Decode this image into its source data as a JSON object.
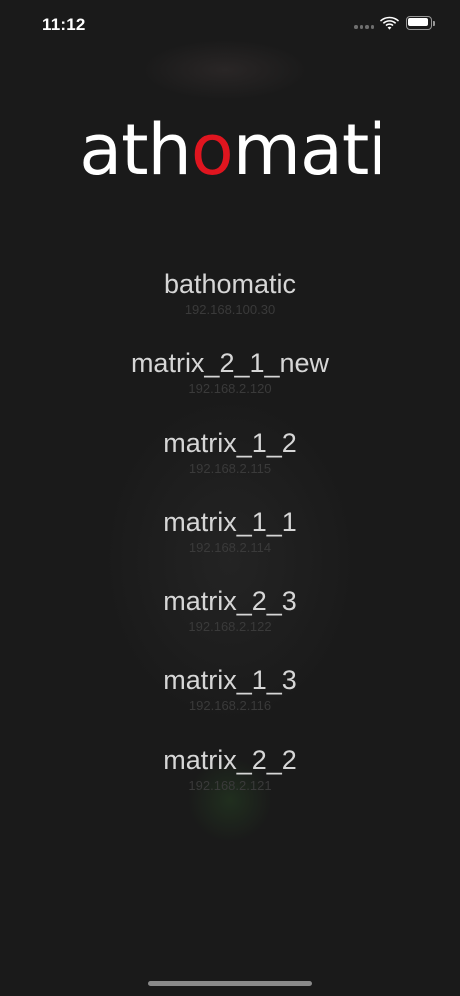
{
  "status_bar": {
    "time": "11:12"
  },
  "logo": {
    "text_before": "bath",
    "text_highlight": "o",
    "text_after": "matic",
    "color_text": "#ffffff",
    "color_highlight": "#e0151f"
  },
  "devices": [
    {
      "name": "bathomatic",
      "ip": "192.168.100.30"
    },
    {
      "name": "matrix_2_1_new",
      "ip": "192.168.2.120"
    },
    {
      "name": "matrix_1_2",
      "ip": "192.168.2.115"
    },
    {
      "name": "matrix_1_1",
      "ip": "192.168.2.114"
    },
    {
      "name": "matrix_2_3",
      "ip": "192.168.2.122"
    },
    {
      "name": "matrix_1_3",
      "ip": "192.168.2.116"
    },
    {
      "name": "matrix_2_2",
      "ip": "192.168.2.121"
    }
  ],
  "icons": {
    "signal": "cellular-signal-icon",
    "wifi": "wifi-icon",
    "battery": "battery-icon"
  }
}
